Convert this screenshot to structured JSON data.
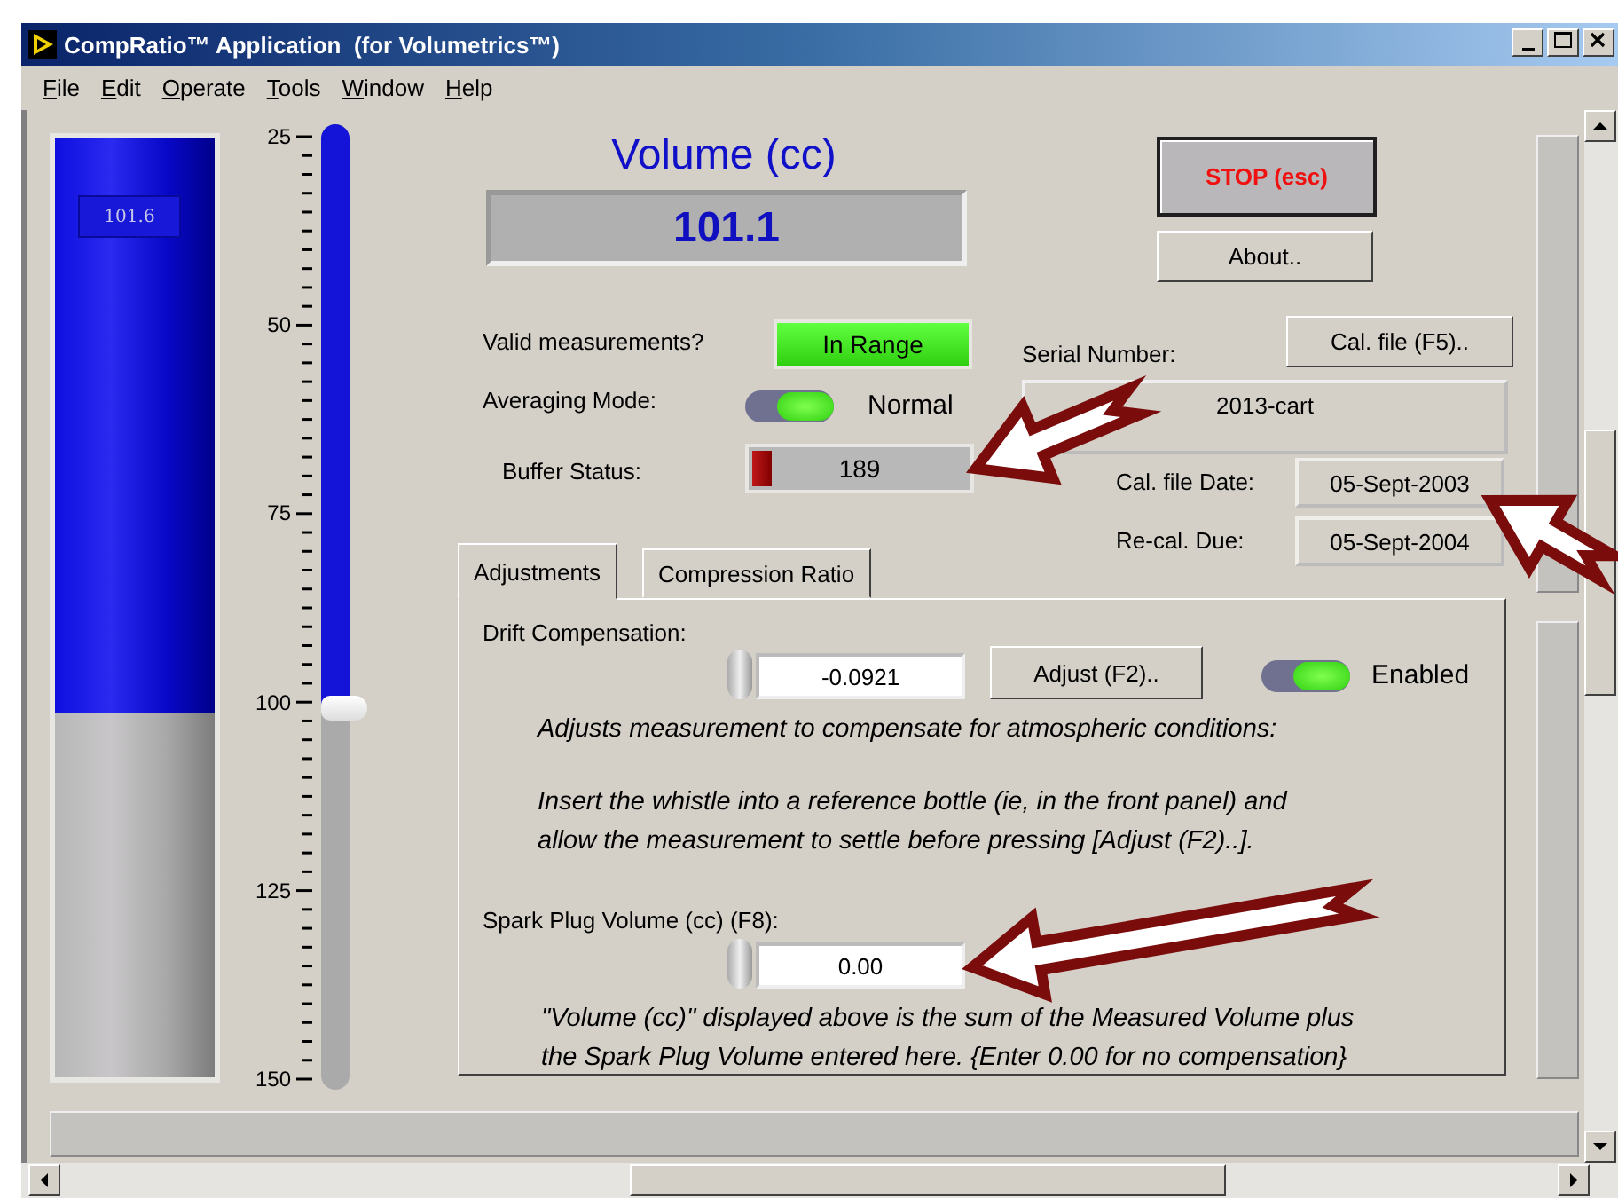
{
  "window": {
    "title": "CompRatio™ Application  (for Volumetrics™)"
  },
  "menu": [
    "File",
    "Edit",
    "Operate",
    "Tools",
    "Window",
    "Help"
  ],
  "tank": {
    "display": "101.6",
    "level": 0.613
  },
  "scale": [
    "25",
    "50",
    "75",
    "100",
    "125",
    "150"
  ],
  "slider": {
    "level": 0.605
  },
  "volume": {
    "label": "Volume (cc)",
    "value": "101.1"
  },
  "stop_button": "STOP (esc)",
  "about_button": "About..",
  "valid": {
    "label": "Valid measurements?",
    "indicator": "In Range",
    "on": true
  },
  "averaging": {
    "label": "Averaging Mode:",
    "on": true,
    "state_text": "Normal"
  },
  "buffer": {
    "label": "Buffer Status:",
    "value": "189",
    "level": 0.09
  },
  "serial": {
    "label": "Serial Number:",
    "value": "2013-cart"
  },
  "cal_file_button": "Cal. file (F5)..",
  "cal_date": {
    "label": "Cal. file Date:",
    "value": "05-Sept-2003"
  },
  "recal_due": {
    "label": "Re-cal. Due:",
    "value": "05-Sept-2004"
  },
  "tabs": [
    {
      "label": "Adjustments",
      "selected": true
    },
    {
      "label": "Compression Ratio",
      "selected": false
    }
  ],
  "drift": {
    "label": "Drift Compensation:",
    "value": "-0.0921",
    "adjust_button": "Adjust (F2)..",
    "enabled": true,
    "state_text": "Enabled",
    "note": "Adjusts measurement to compensate for atmospheric conditions:",
    "instructions": [
      "Insert the whistle into a reference bottle (ie, in the front panel) and",
      "allow the measurement to settle before pressing [Adjust (F2)..]."
    ]
  },
  "spark": {
    "label": "Spark Plug Volume (cc)  (F8):",
    "value": "0.00",
    "note": [
      "\"Volume (cc)\" displayed above is the sum of the Measured Volume plus",
      "the Spark Plug Volume entered here.  {Enter 0.00 for no compensation}"
    ]
  }
}
